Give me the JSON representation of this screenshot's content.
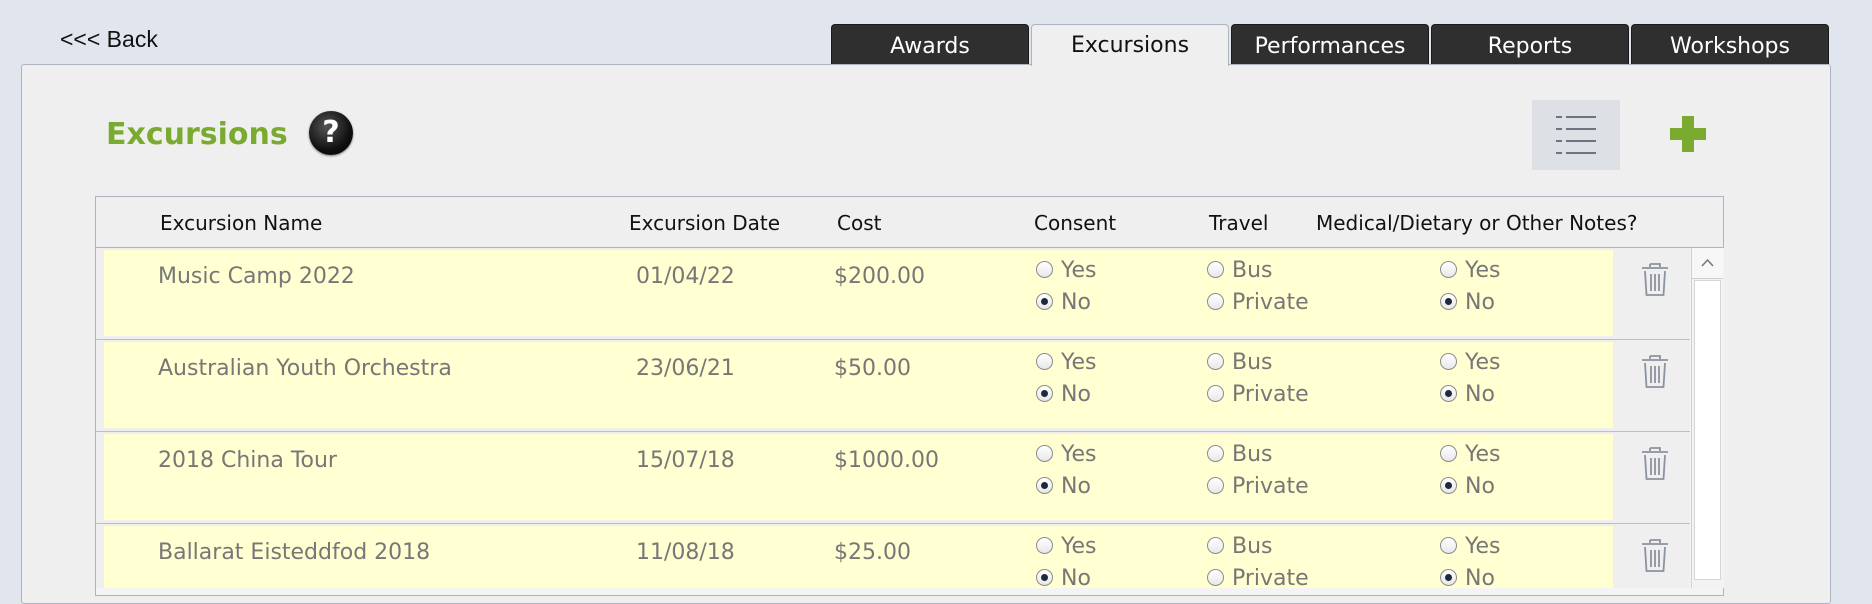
{
  "nav": {
    "back_label": "<<< Back"
  },
  "tabs": [
    {
      "label": "Awards"
    },
    {
      "label": "Excursions"
    },
    {
      "label": "Performances"
    },
    {
      "label": "Reports"
    },
    {
      "label": "Workshops"
    }
  ],
  "active_tab": "Excursions",
  "page": {
    "title": "Excursions",
    "help_symbol": "?"
  },
  "colors": {
    "accent": "#7aaa2f",
    "row_background": "#ffffd2",
    "tab_dark": "#2f2f2f"
  },
  "table": {
    "headers": {
      "name": "Excursion Name",
      "date": "Excursion Date",
      "cost": "Cost",
      "consent": "Consent",
      "travel": "Travel",
      "notes": "Medical/Dietary or Other Notes?"
    },
    "option_labels": {
      "yes": "Yes",
      "no": "No",
      "bus": "Bus",
      "private": "Private"
    },
    "rows": [
      {
        "name": "Music Camp 2022",
        "date": "01/04/22",
        "cost": "$200.00",
        "consent": "No",
        "travel": null,
        "notes": "No"
      },
      {
        "name": "Australian Youth Orchestra",
        "date": "23/06/21",
        "cost": "$50.00",
        "consent": "No",
        "travel": null,
        "notes": "No"
      },
      {
        "name": "2018 China Tour",
        "date": "15/07/18",
        "cost": "$1000.00",
        "consent": "No",
        "travel": null,
        "notes": "No"
      },
      {
        "name": "Ballarat Eisteddfod 2018",
        "date": "11/08/18",
        "cost": "$25.00",
        "consent": "No",
        "travel": null,
        "notes": "No"
      }
    ]
  },
  "icons": {
    "help": "help-icon",
    "list": "list-view-icon",
    "add": "plus-icon",
    "delete": "trash-icon",
    "scroll_up": "chevron-up-icon"
  }
}
